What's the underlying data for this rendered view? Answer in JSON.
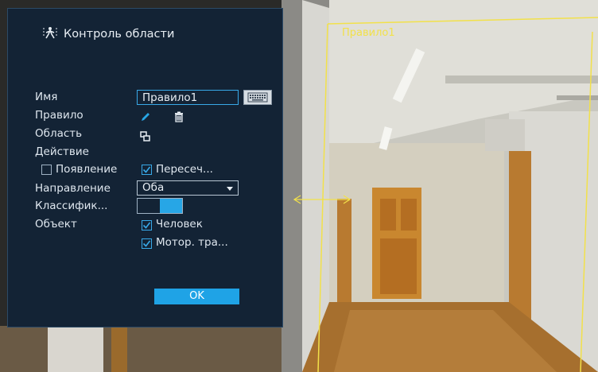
{
  "panel": {
    "title": "Контроль области",
    "fields": {
      "name_label": "Имя",
      "name_value": "Правило1",
      "rule_label": "Правило",
      "area_label": "Область",
      "action_label": "Действие",
      "direction_label": "Направление",
      "classification_label": "Классифик...",
      "object_label": "Объект"
    },
    "action_options": [
      {
        "label": "Появление",
        "checked": false
      },
      {
        "label": "Пересеч...",
        "checked": true
      }
    ],
    "direction_value": "Оба",
    "classification_enabled": true,
    "object_options": [
      {
        "label": "Человек",
        "checked": true
      },
      {
        "label": "Мотор. тра...",
        "checked": true
      }
    ],
    "ok_label": "OK"
  },
  "video": {
    "rule_overlay_label": "Правило1",
    "overlay_color": "#f2e14a"
  },
  "colors": {
    "panel_bg": "#132335",
    "accent": "#27a6e6"
  }
}
